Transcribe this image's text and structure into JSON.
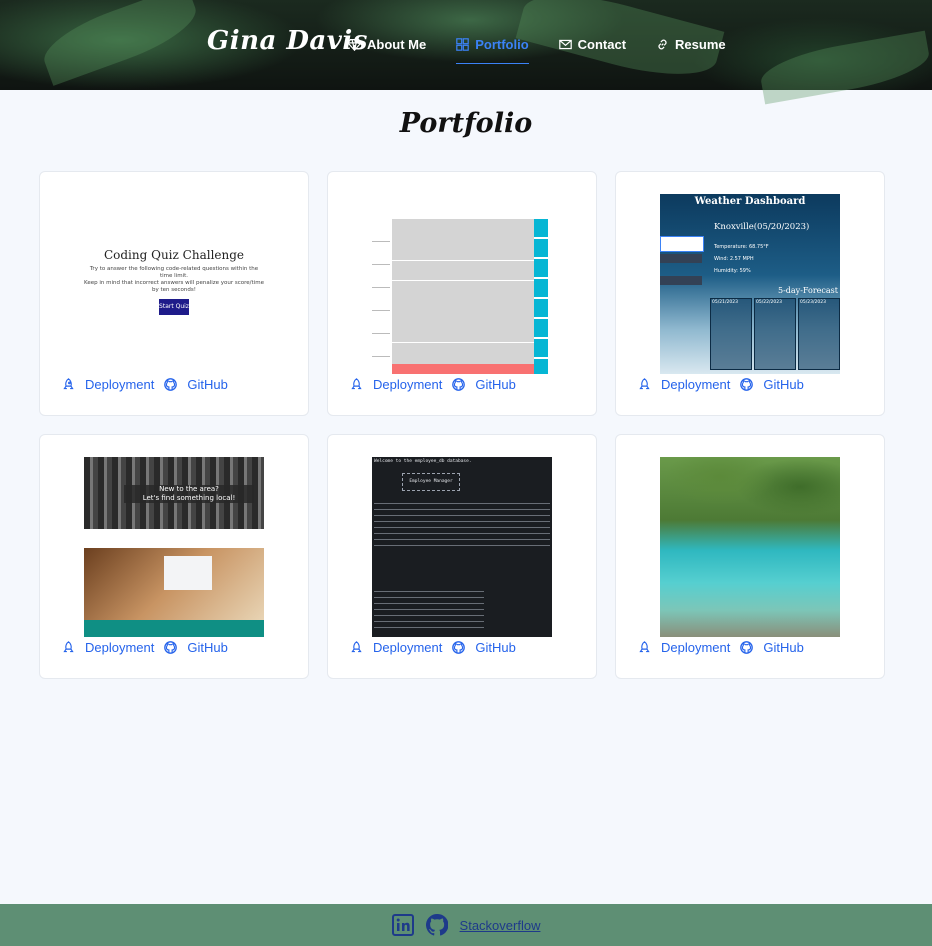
{
  "brand": "Gina Davis",
  "nav": [
    {
      "label": "About Me",
      "icon": "diamond-icon"
    },
    {
      "label": "Portfolio",
      "icon": "grid-icon",
      "active": true
    },
    {
      "label": "Contact",
      "icon": "mail-icon"
    },
    {
      "label": "Resume",
      "icon": "link-icon"
    }
  ],
  "page_title": "Portfolio",
  "cards": [
    {
      "deployment": "Deployment",
      "github": "GitHub",
      "thumb": {
        "title": "Coding Quiz Challenge",
        "line1": "Try to answer the following code-related questions within the",
        "line2": "time limit.",
        "line3": "Keep in mind that incorrect answers will penalize your score/time",
        "line4": "by ten seconds!",
        "button": "Start Quiz"
      }
    },
    {
      "deployment": "Deployment",
      "github": "GitHub",
      "thumb": {
        "rows": [
          "9AM",
          "10AM",
          "11AM",
          "12PM",
          "1PM",
          "2PM",
          "3PM",
          "4PM",
          "5PM"
        ]
      }
    },
    {
      "deployment": "Deployment",
      "github": "GitHub",
      "thumb": {
        "title": "Weather Dashboard",
        "city": "Knoxville(05/20/2023)",
        "temp": "Temperature: 68.75°F",
        "wind": "Wind: 2.57 MPH",
        "humidity": "Humidity: 59%",
        "forecast": "5-day-Forecast",
        "dates": [
          "05/21/2023",
          "05/22/2023",
          "05/23/2023"
        ]
      }
    },
    {
      "deployment": "Deployment",
      "github": "GitHub",
      "thumb": {
        "headline1": "New to the area?",
        "headline2": "Let's find something local!"
      }
    },
    {
      "deployment": "Deployment",
      "github": "GitHub",
      "thumb": {
        "header": "Welcome to the employee_db database.",
        "box": "Employee Manager"
      }
    },
    {
      "deployment": "Deployment",
      "github": "GitHub",
      "thumb": {}
    }
  ],
  "footer": {
    "stackoverflow": "Stackoverflow"
  },
  "colors": {
    "accent": "#3b82f6",
    "link": "#2563eb",
    "footer_bg": "#5e8f74",
    "page_bg": "#f5f8fd"
  }
}
